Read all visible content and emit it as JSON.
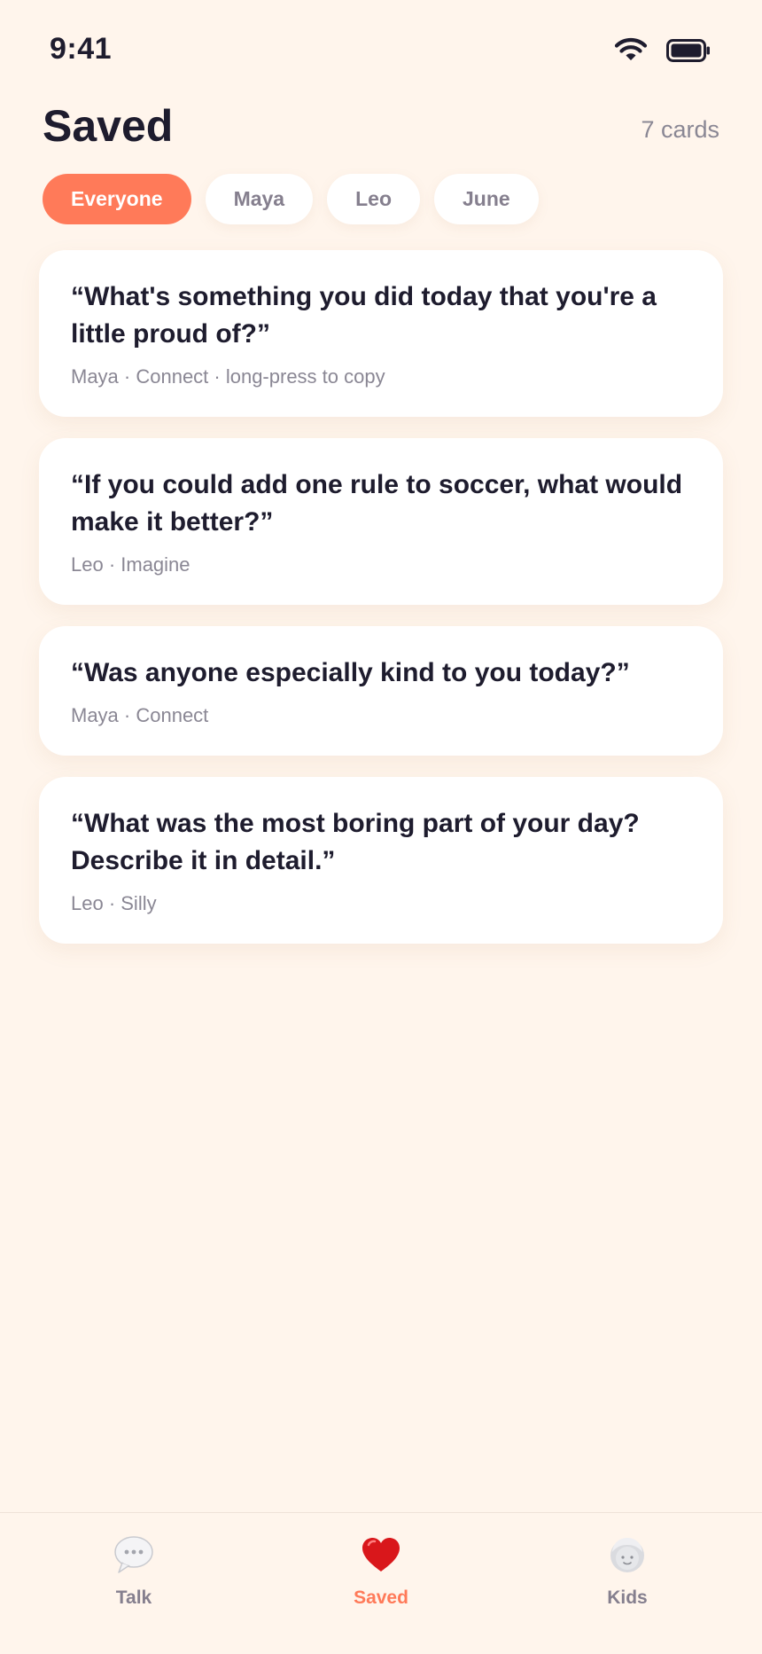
{
  "status_bar": {
    "time": "9:41",
    "wifi_icon": "wifi-icon",
    "battery_icon": "battery-icon"
  },
  "header": {
    "title": "Saved",
    "count": "7 cards"
  },
  "filters": [
    {
      "label": "Everyone",
      "active": true
    },
    {
      "label": "Maya",
      "active": false
    },
    {
      "label": "Leo",
      "active": false
    },
    {
      "label": "June",
      "active": false
    }
  ],
  "cards": [
    {
      "question": "“What's something you did today that you're a little proud of?”",
      "meta": "Maya · Connect · long-press to copy"
    },
    {
      "question": "“If you could add one rule to soccer, what would make it better?”",
      "meta": "Leo · Imagine"
    },
    {
      "question": "“Was anyone especially kind to you today?”",
      "meta": "Maya · Connect"
    },
    {
      "question": "“What was the most boring part of your day? Describe it in detail.”",
      "meta": "Leo · Silly"
    }
  ],
  "tabs": [
    {
      "label": "Talk",
      "icon": "speech-bubble-icon",
      "active": false
    },
    {
      "label": "Saved",
      "icon": "heart-icon",
      "active": true
    },
    {
      "label": "Kids",
      "icon": "child-face-icon",
      "active": false
    }
  ],
  "colors": {
    "background": "#FFF5EC",
    "accent": "#FF7A59",
    "text_primary": "#1E1C2E",
    "text_secondary": "#8A8794",
    "heart": "#D9171B"
  }
}
